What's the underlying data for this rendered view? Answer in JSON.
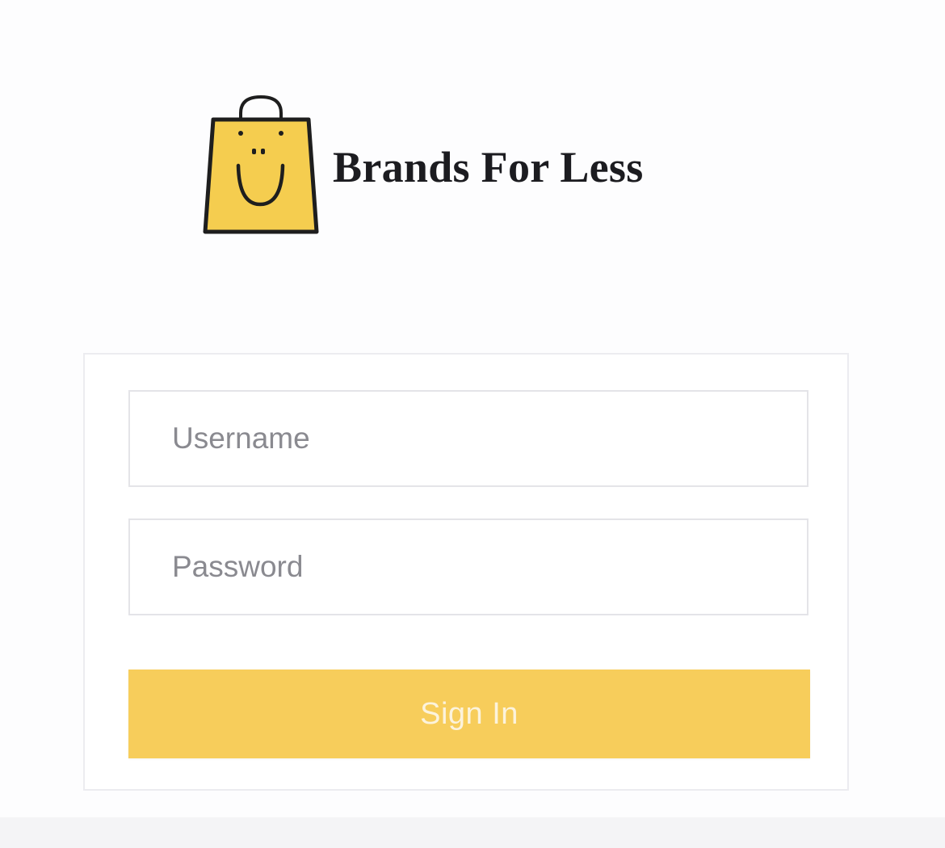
{
  "brand": {
    "name": "Brands For Less",
    "logo_icon": "smiling-shopping-bag-icon",
    "logo_color": "#f5cd4f"
  },
  "login": {
    "username_placeholder": "Username",
    "password_placeholder": "Password",
    "signin_label": "Sign In"
  },
  "colors": {
    "accent": "#f7cd5b",
    "button_text": "#fcf3dc"
  }
}
